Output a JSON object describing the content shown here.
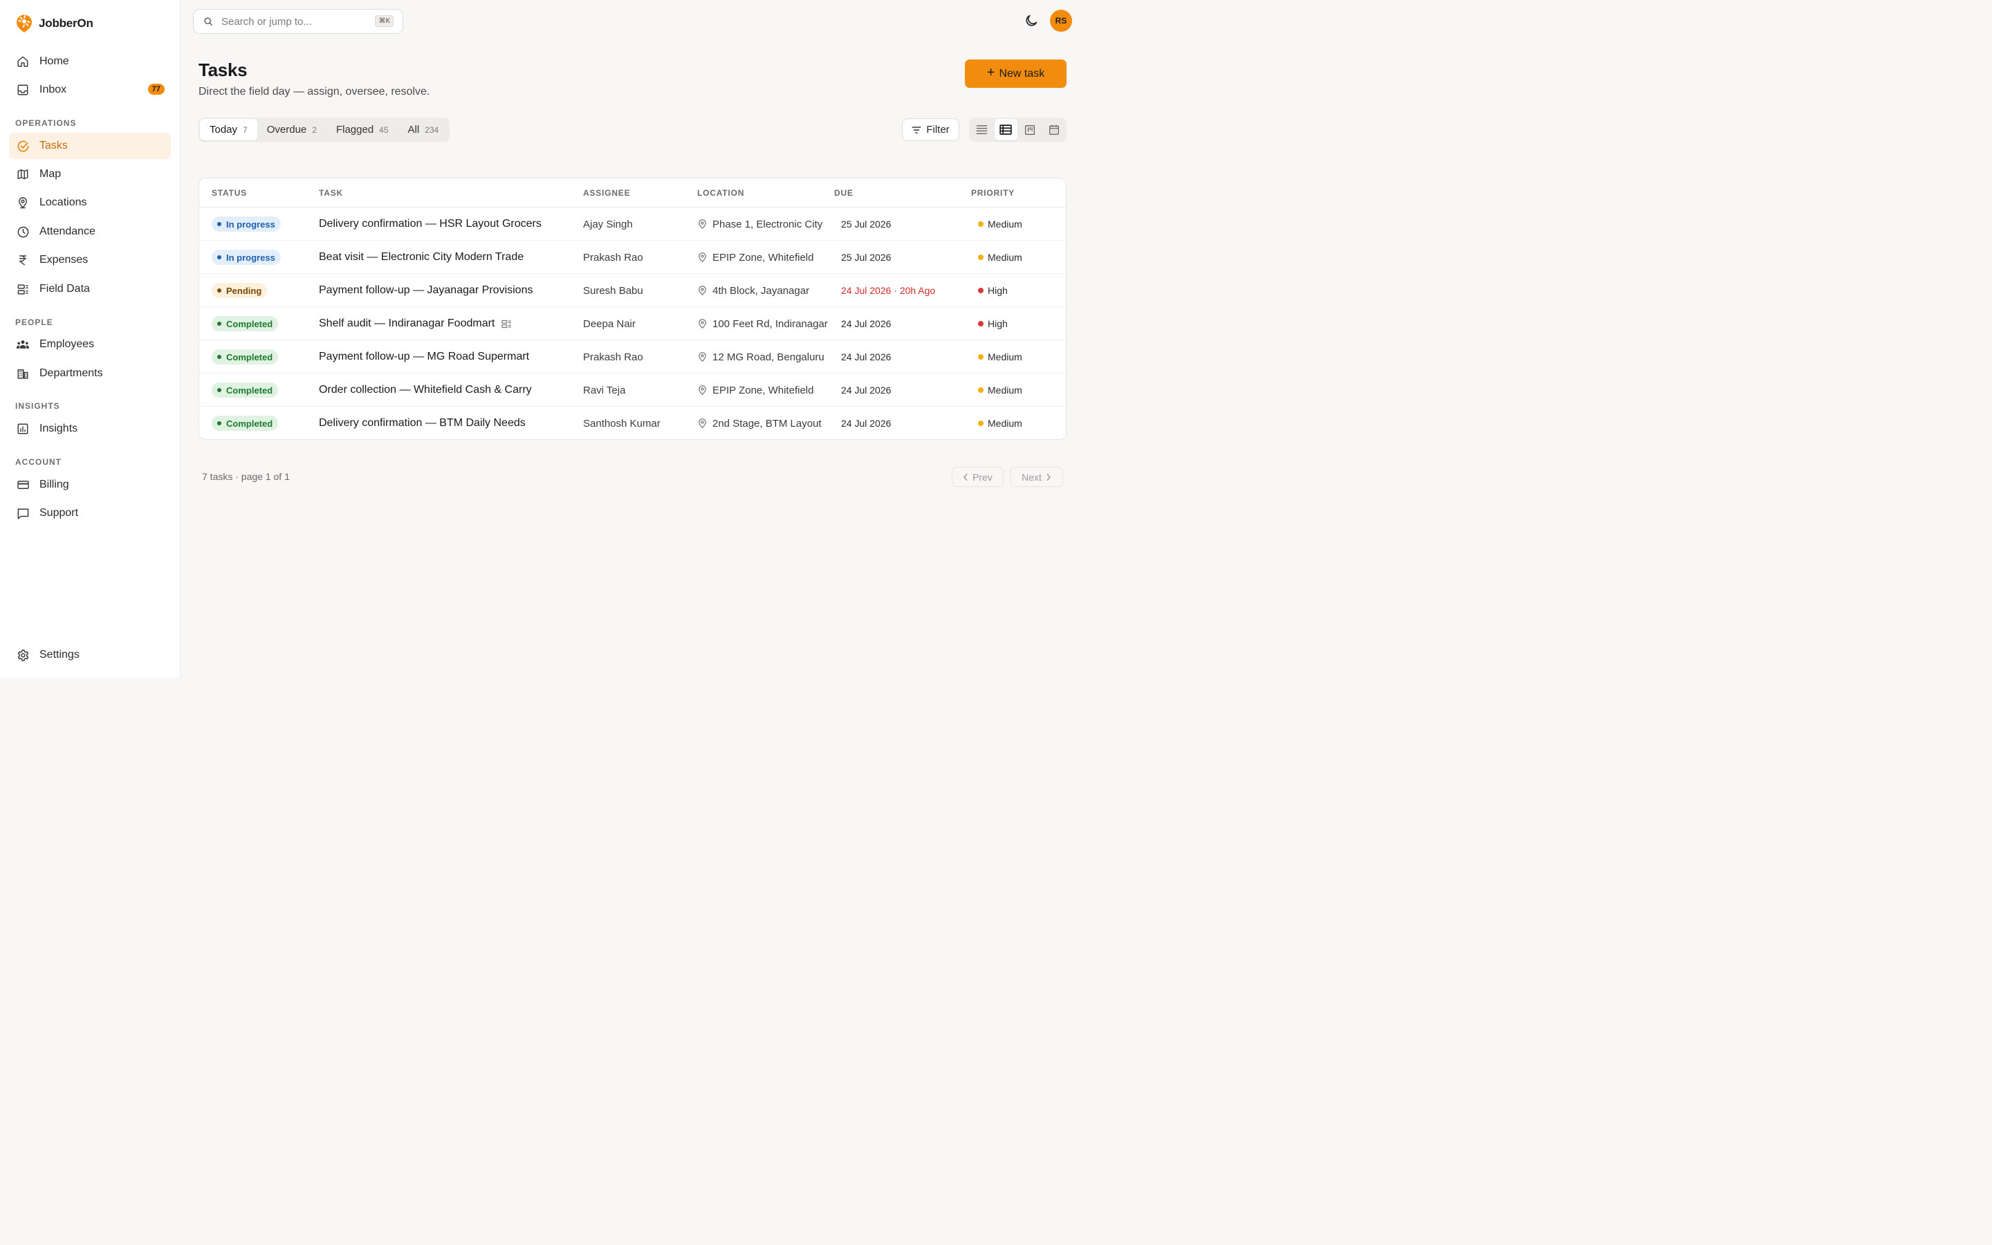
{
  "brand": {
    "name": "JobberOn",
    "logo_color": "#f28c0f"
  },
  "sidebar": {
    "home": {
      "label": "Home",
      "icon": "home-icon"
    },
    "inbox": {
      "label": "Inbox",
      "icon": "inbox-icon",
      "badge": "77"
    },
    "sections": {
      "operations": "OPERATIONS",
      "people": "PEOPLE",
      "insights": "INSIGHTS",
      "account": "ACCOUNT"
    },
    "operations": [
      {
        "label": "Tasks",
        "icon": "check-circle-icon",
        "active": true
      },
      {
        "label": "Map",
        "icon": "map-icon"
      },
      {
        "label": "Locations",
        "icon": "location-pin-icon"
      },
      {
        "label": "Attendance",
        "icon": "clock-icon"
      },
      {
        "label": "Expenses",
        "icon": "rupee-icon"
      },
      {
        "label": "Field Data",
        "icon": "form-icon"
      }
    ],
    "people": [
      {
        "label": "Employees",
        "icon": "users-icon"
      },
      {
        "label": "Departments",
        "icon": "building-icon"
      }
    ],
    "insights": [
      {
        "label": "Insights",
        "icon": "bar-chart-icon"
      }
    ],
    "account": [
      {
        "label": "Billing",
        "icon": "credit-card-icon"
      },
      {
        "label": "Support",
        "icon": "message-icon"
      }
    ],
    "settings": {
      "label": "Settings",
      "icon": "gear-icon"
    }
  },
  "topbar": {
    "search_placeholder": "Search or jump to...",
    "shortcut": "⌘K",
    "avatar_initials": "RS"
  },
  "header": {
    "title": "Tasks",
    "subtitle": "Direct the field day — assign, oversee, resolve.",
    "new_button": "New task"
  },
  "tabs": [
    {
      "label": "Today",
      "count": "7",
      "active": true
    },
    {
      "label": "Overdue",
      "count": "2"
    },
    {
      "label": "Flagged",
      "count": "45"
    },
    {
      "label": "All",
      "count": "234"
    }
  ],
  "filter_label": "Filter",
  "table": {
    "columns": [
      "STATUS",
      "TASK",
      "ASSIGNEE",
      "LOCATION",
      "DUE",
      "PRIORITY"
    ],
    "rows": [
      {
        "status": "In progress",
        "task": "Delivery confirmation — HSR Layout Grocers",
        "assignee": "Ajay Singh",
        "location": "Phase 1, Electronic City",
        "due": "25 Jul 2026",
        "overdue": false,
        "priority": "Medium",
        "has_form": false
      },
      {
        "status": "In progress",
        "task": "Beat visit — Electronic City Modern Trade",
        "assignee": "Prakash Rao",
        "location": "EPIP Zone, Whitefield",
        "due": "25 Jul 2026",
        "overdue": false,
        "priority": "Medium",
        "has_form": false
      },
      {
        "status": "Pending",
        "task": "Payment follow-up — Jayanagar Provisions",
        "assignee": "Suresh Babu",
        "location": "4th Block, Jayanagar",
        "due": "24 Jul 2026 · 20h Ago",
        "overdue": true,
        "priority": "High",
        "has_form": false
      },
      {
        "status": "Completed",
        "task": "Shelf audit — Indiranagar Foodmart",
        "assignee": "Deepa Nair",
        "location": "100 Feet Rd, Indiranagar",
        "due": "24 Jul 2026",
        "overdue": false,
        "priority": "High",
        "has_form": true
      },
      {
        "status": "Completed",
        "task": "Payment follow-up — MG Road Supermart",
        "assignee": "Prakash Rao",
        "location": "12 MG Road, Bengaluru",
        "due": "24 Jul 2026",
        "overdue": false,
        "priority": "Medium",
        "has_form": false
      },
      {
        "status": "Completed",
        "task": "Order collection — Whitefield Cash & Carry",
        "assignee": "Ravi Teja",
        "location": "EPIP Zone, Whitefield",
        "due": "24 Jul 2026",
        "overdue": false,
        "priority": "Medium",
        "has_form": false
      },
      {
        "status": "Completed",
        "task": "Delivery confirmation — BTM Daily Needs",
        "assignee": "Santhosh Kumar",
        "location": "2nd Stage, BTM Layout",
        "due": "24 Jul 2026",
        "overdue": false,
        "priority": "Medium",
        "has_form": false
      }
    ]
  },
  "footer": {
    "summary": "7 tasks · page 1 of 1",
    "prev": "Prev",
    "next": "Next"
  },
  "colors": {
    "accent": "#f28c0f",
    "in_progress_bg": "#e3eefb",
    "in_progress_fg": "#1f5fb0",
    "pending_bg": "#fdf0dc",
    "pending_fg": "#7a4a00",
    "completed_bg": "#e0f3e3",
    "completed_fg": "#1d7a2e",
    "priority_medium": "#f2b311",
    "priority_high": "#d63a3a",
    "overdue_text": "#d42b2b"
  }
}
